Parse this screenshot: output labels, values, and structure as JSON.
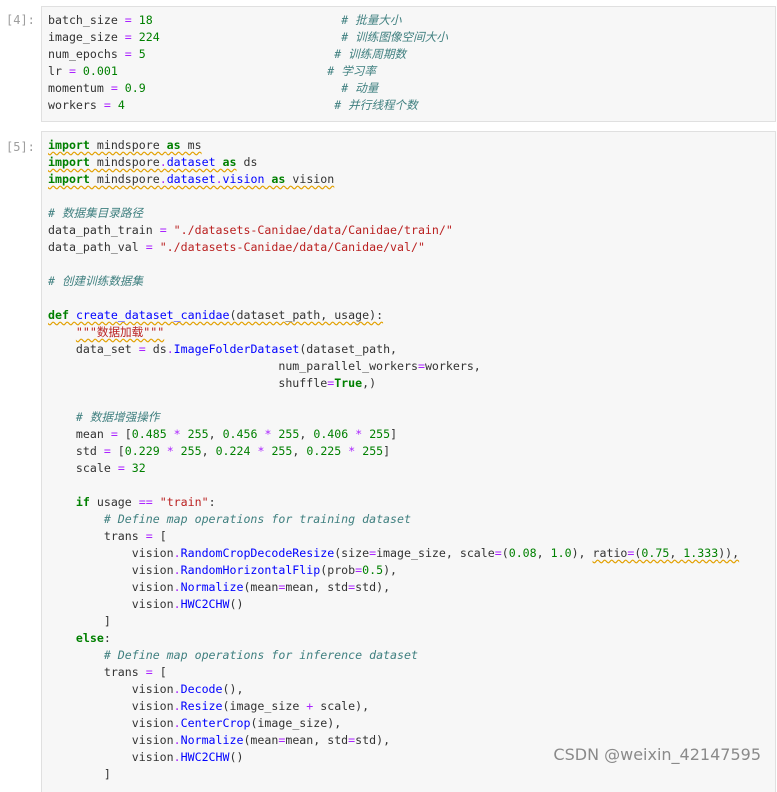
{
  "cells": [
    {
      "prompt": "[4]:",
      "lines": [
        [
          [
            "",
            "batch_size "
          ],
          [
            "op",
            "="
          ],
          [
            "",
            " "
          ],
          [
            "num",
            "18"
          ],
          [
            "",
            "                           "
          ],
          [
            "cm",
            "# 批量大小"
          ]
        ],
        [
          [
            "",
            "image_size "
          ],
          [
            "op",
            "="
          ],
          [
            "",
            " "
          ],
          [
            "num",
            "224"
          ],
          [
            "",
            "                          "
          ],
          [
            "cm",
            "# 训练图像空间大小"
          ]
        ],
        [
          [
            "",
            "num_epochs "
          ],
          [
            "op",
            "="
          ],
          [
            "",
            " "
          ],
          [
            "num",
            "5"
          ],
          [
            "",
            "                           "
          ],
          [
            "cm",
            "# 训练周期数"
          ]
        ],
        [
          [
            "",
            "lr "
          ],
          [
            "op",
            "="
          ],
          [
            "",
            " "
          ],
          [
            "num",
            "0.001"
          ],
          [
            "",
            "                              "
          ],
          [
            "cm",
            "# 学习率"
          ]
        ],
        [
          [
            "",
            "momentum "
          ],
          [
            "op",
            "="
          ],
          [
            "",
            " "
          ],
          [
            "num",
            "0.9"
          ],
          [
            "",
            "                            "
          ],
          [
            "cm",
            "# 动量"
          ]
        ],
        [
          [
            "",
            "workers "
          ],
          [
            "op",
            "="
          ],
          [
            "",
            " "
          ],
          [
            "num",
            "4"
          ],
          [
            "",
            "                              "
          ],
          [
            "cm",
            "# 并行线程个数"
          ]
        ]
      ]
    },
    {
      "prompt": "[5]:",
      "lines": [
        [
          [
            "kw spell",
            "import"
          ],
          [
            "spell",
            " mindspore "
          ],
          [
            "kw spell",
            "as"
          ],
          [
            "spell",
            " ms"
          ]
        ],
        [
          [
            "kw spell",
            "import"
          ],
          [
            "spell",
            " mindspore"
          ],
          [
            "op spell",
            "."
          ],
          [
            "attr spell",
            "dataset"
          ],
          [
            "spell",
            " "
          ],
          [
            "kw spell",
            "as"
          ],
          [
            "",
            " ds"
          ]
        ],
        [
          [
            "kw spell",
            "import"
          ],
          [
            "spell",
            " mindspore"
          ],
          [
            "op spell",
            "."
          ],
          [
            "attr spell",
            "dataset"
          ],
          [
            "op spell",
            "."
          ],
          [
            "attr spell",
            "vision"
          ],
          [
            "spell",
            " "
          ],
          [
            "kw spell",
            "as"
          ],
          [
            "spell",
            " vision"
          ]
        ],
        [
          [
            "",
            ""
          ]
        ],
        [
          [
            "cm",
            "# 数据集目录路径"
          ]
        ],
        [
          [
            "",
            "data_path_train "
          ],
          [
            "op",
            "="
          ],
          [
            "",
            " "
          ],
          [
            "str",
            "\"./datasets-Canidae/data/Canidae/train/\""
          ]
        ],
        [
          [
            "",
            "data_path_val "
          ],
          [
            "op",
            "="
          ],
          [
            "",
            " "
          ],
          [
            "str",
            "\"./datasets-Canidae/data/Canidae/val/\""
          ]
        ],
        [
          [
            "",
            ""
          ]
        ],
        [
          [
            "cm",
            "# 创建训练数据集"
          ]
        ],
        [
          [
            "",
            ""
          ]
        ],
        [
          [
            "kw spell",
            "def"
          ],
          [
            "spell",
            " "
          ],
          [
            "fn spell",
            "create_dataset_canidae"
          ],
          [
            "spell",
            "(dataset_path, usage):"
          ]
        ],
        [
          [
            "",
            "    "
          ],
          [
            "str spell",
            "\"\"\"数据加载\"\"\""
          ]
        ],
        [
          [
            "",
            "    data_set "
          ],
          [
            "op",
            "="
          ],
          [
            "",
            " ds"
          ],
          [
            "op",
            "."
          ],
          [
            "attr",
            "ImageFolderDataset"
          ],
          [
            "",
            "(dataset_path,"
          ]
        ],
        [
          [
            "",
            "                                 num_parallel_workers"
          ],
          [
            "op",
            "="
          ],
          [
            "",
            "workers,"
          ]
        ],
        [
          [
            "",
            "                                 shuffle"
          ],
          [
            "op",
            "="
          ],
          [
            "kw",
            "True"
          ],
          [
            "",
            ",)"
          ]
        ],
        [
          [
            "",
            ""
          ]
        ],
        [
          [
            "",
            "    "
          ],
          [
            "cm",
            "# 数据增强操作"
          ]
        ],
        [
          [
            "",
            "    mean "
          ],
          [
            "op",
            "="
          ],
          [
            "",
            " ["
          ],
          [
            "num",
            "0.485"
          ],
          [
            "",
            " "
          ],
          [
            "op",
            "*"
          ],
          [
            "",
            " "
          ],
          [
            "num",
            "255"
          ],
          [
            "",
            ", "
          ],
          [
            "num",
            "0.456"
          ],
          [
            "",
            " "
          ],
          [
            "op",
            "*"
          ],
          [
            "",
            " "
          ],
          [
            "num",
            "255"
          ],
          [
            "",
            ", "
          ],
          [
            "num",
            "0.406"
          ],
          [
            "",
            " "
          ],
          [
            "op",
            "*"
          ],
          [
            "",
            " "
          ],
          [
            "num",
            "255"
          ],
          [
            "",
            "]"
          ]
        ],
        [
          [
            "",
            "    std "
          ],
          [
            "op",
            "="
          ],
          [
            "",
            " ["
          ],
          [
            "num",
            "0.229"
          ],
          [
            "",
            " "
          ],
          [
            "op",
            "*"
          ],
          [
            "",
            " "
          ],
          [
            "num",
            "255"
          ],
          [
            "",
            ", "
          ],
          [
            "num",
            "0.224"
          ],
          [
            "",
            " "
          ],
          [
            "op",
            "*"
          ],
          [
            "",
            " "
          ],
          [
            "num",
            "255"
          ],
          [
            "",
            ", "
          ],
          [
            "num",
            "0.225"
          ],
          [
            "",
            " "
          ],
          [
            "op",
            "*"
          ],
          [
            "",
            " "
          ],
          [
            "num",
            "255"
          ],
          [
            "",
            "]"
          ]
        ],
        [
          [
            "",
            "    scale "
          ],
          [
            "op",
            "="
          ],
          [
            "",
            " "
          ],
          [
            "num",
            "32"
          ]
        ],
        [
          [
            "",
            ""
          ]
        ],
        [
          [
            "",
            "    "
          ],
          [
            "kw",
            "if"
          ],
          [
            "",
            " usage "
          ],
          [
            "op",
            "=="
          ],
          [
            "",
            " "
          ],
          [
            "str",
            "\"train\""
          ],
          [
            "",
            ":"
          ]
        ],
        [
          [
            "",
            "        "
          ],
          [
            "cm",
            "# Define map operations for training dataset"
          ]
        ],
        [
          [
            "",
            "        trans "
          ],
          [
            "op",
            "="
          ],
          [
            "",
            " ["
          ]
        ],
        [
          [
            "",
            "            vision"
          ],
          [
            "op",
            "."
          ],
          [
            "attr",
            "RandomCropDecodeResize"
          ],
          [
            "",
            "(size"
          ],
          [
            "op",
            "="
          ],
          [
            "",
            "image_size, scale"
          ],
          [
            "op",
            "="
          ],
          [
            "",
            "("
          ],
          [
            "num",
            "0.08"
          ],
          [
            "",
            ", "
          ],
          [
            "num",
            "1.0"
          ],
          [
            "",
            "), "
          ],
          [
            "spell",
            "ratio"
          ],
          [
            "op spell",
            "="
          ],
          [
            "spell",
            "("
          ],
          [
            "num spell",
            "0.75"
          ],
          [
            "spell",
            ", "
          ],
          [
            "num spell",
            "1.333"
          ],
          [
            "spell",
            ")),"
          ]
        ],
        [
          [
            "",
            "            vision"
          ],
          [
            "op",
            "."
          ],
          [
            "attr",
            "RandomHorizontalFlip"
          ],
          [
            "",
            "(prob"
          ],
          [
            "op",
            "="
          ],
          [
            "num",
            "0.5"
          ],
          [
            "",
            "),"
          ]
        ],
        [
          [
            "",
            "            vision"
          ],
          [
            "op",
            "."
          ],
          [
            "attr",
            "Normalize"
          ],
          [
            "",
            "(mean"
          ],
          [
            "op",
            "="
          ],
          [
            "",
            "mean, std"
          ],
          [
            "op",
            "="
          ],
          [
            "",
            "std),"
          ]
        ],
        [
          [
            "",
            "            vision"
          ],
          [
            "op",
            "."
          ],
          [
            "attr",
            "HWC2CHW"
          ],
          [
            "",
            "()"
          ]
        ],
        [
          [
            "",
            "        ]"
          ]
        ],
        [
          [
            "",
            "    "
          ],
          [
            "kw",
            "else"
          ],
          [
            "",
            ":"
          ]
        ],
        [
          [
            "",
            "        "
          ],
          [
            "cm",
            "# Define map operations for inference dataset"
          ]
        ],
        [
          [
            "",
            "        trans "
          ],
          [
            "op",
            "="
          ],
          [
            "",
            " ["
          ]
        ],
        [
          [
            "",
            "            vision"
          ],
          [
            "op",
            "."
          ],
          [
            "attr",
            "Decode"
          ],
          [
            "",
            "(),"
          ]
        ],
        [
          [
            "",
            "            vision"
          ],
          [
            "op",
            "."
          ],
          [
            "attr",
            "Resize"
          ],
          [
            "",
            "(image_size "
          ],
          [
            "op",
            "+"
          ],
          [
            "",
            " scale),"
          ]
        ],
        [
          [
            "",
            "            vision"
          ],
          [
            "op",
            "."
          ],
          [
            "attr",
            "CenterCrop"
          ],
          [
            "",
            "(image_size),"
          ]
        ],
        [
          [
            "",
            "            vision"
          ],
          [
            "op",
            "."
          ],
          [
            "attr",
            "Normalize"
          ],
          [
            "",
            "(mean"
          ],
          [
            "op",
            "="
          ],
          [
            "",
            "mean, std"
          ],
          [
            "op",
            "="
          ],
          [
            "",
            "std),"
          ]
        ],
        [
          [
            "",
            "            vision"
          ],
          [
            "op",
            "."
          ],
          [
            "attr",
            "HWC2CHW"
          ],
          [
            "",
            "()"
          ]
        ],
        [
          [
            "",
            "        ]"
          ]
        ]
      ]
    }
  ],
  "watermark": "CSDN @weixin_42147595"
}
